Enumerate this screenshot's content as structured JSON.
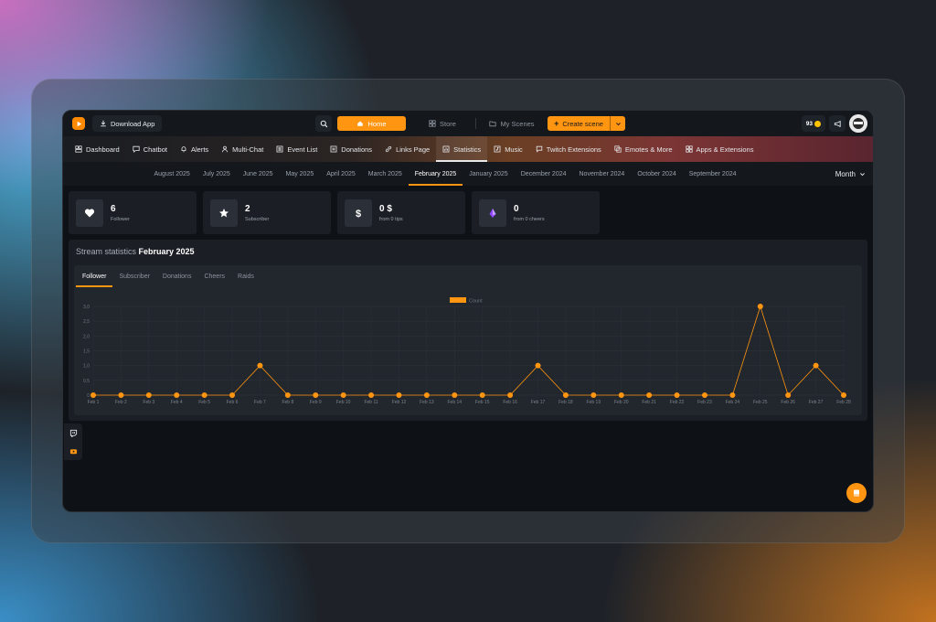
{
  "topbar": {
    "download_label": "Download App",
    "home_label": "Home",
    "store_label": "Store",
    "scenes_label": "My Scenes",
    "create_label": "Create scene",
    "coins": "93"
  },
  "nav": [
    {
      "label": "Dashboard",
      "icon": "dashboard-icon"
    },
    {
      "label": "Chatbot",
      "icon": "chat-icon"
    },
    {
      "label": "Alerts",
      "icon": "bell-icon"
    },
    {
      "label": "Multi-Chat",
      "icon": "person-icon"
    },
    {
      "label": "Event List",
      "icon": "list-icon"
    },
    {
      "label": "Donations",
      "icon": "donation-icon"
    },
    {
      "label": "Links Page",
      "icon": "link-icon"
    },
    {
      "label": "Statistics",
      "icon": "stats-icon",
      "active": true
    },
    {
      "label": "Music",
      "icon": "music-icon"
    },
    {
      "label": "Twitch Extensions",
      "icon": "extension-icon"
    },
    {
      "label": "Emotes & More",
      "icon": "emote-icon"
    },
    {
      "label": "Apps & Extensions",
      "icon": "apps-icon"
    }
  ],
  "months": [
    "August 2025",
    "July 2025",
    "June 2025",
    "May 2025",
    "April 2025",
    "March 2025",
    "February 2025",
    "January 2025",
    "December 2024",
    "November 2024",
    "October 2024",
    "September 2024"
  ],
  "active_month": "February 2025",
  "period_label": "Month",
  "cards": [
    {
      "value": "6",
      "label": "Follower",
      "icon": "heart-icon"
    },
    {
      "value": "2",
      "label": "Subscriber",
      "icon": "star-icon"
    },
    {
      "value": "0 $",
      "label": "from 0 tips",
      "icon": "dollar-icon"
    },
    {
      "value": "0",
      "label": "from 0 cheers",
      "icon": "bits-icon"
    }
  ],
  "panel": {
    "title_prefix": "Stream statistics",
    "title_month": "February 2025"
  },
  "chart_tabs": [
    "Follower",
    "Subscriber",
    "Donations",
    "Cheers",
    "Raids"
  ],
  "colors": {
    "accent": "#ff9511",
    "background": "#0e1115"
  },
  "chart_data": {
    "type": "line",
    "categories": [
      "Feb 1",
      "Feb 2",
      "Feb 3",
      "Feb 4",
      "Feb 5",
      "Feb 6",
      "Feb 7",
      "Feb 8",
      "Feb 9",
      "Feb 10",
      "Feb 11",
      "Feb 12",
      "Feb 13",
      "Feb 14",
      "Feb 15",
      "Feb 16",
      "Feb 17",
      "Feb 18",
      "Feb 19",
      "Feb 20",
      "Feb 21",
      "Feb 22",
      "Feb 23",
      "Feb 24",
      "Feb 25",
      "Feb 26",
      "Feb 27",
      "Feb 28"
    ],
    "series": [
      {
        "name": "Count",
        "values": [
          0,
          0,
          0,
          0,
          0,
          0,
          1,
          0,
          0,
          0,
          0,
          0,
          0,
          0,
          0,
          0,
          1,
          0,
          0,
          0,
          0,
          0,
          0,
          0,
          3,
          0,
          1,
          0
        ],
        "color": "#ff9511"
      }
    ],
    "y_ticks": [
      "0",
      "0,5",
      "1,0",
      "1,5",
      "2,0",
      "2,5",
      "3,0"
    ],
    "ylim": [
      0,
      3
    ],
    "legend": "top-center",
    "grid": true
  }
}
